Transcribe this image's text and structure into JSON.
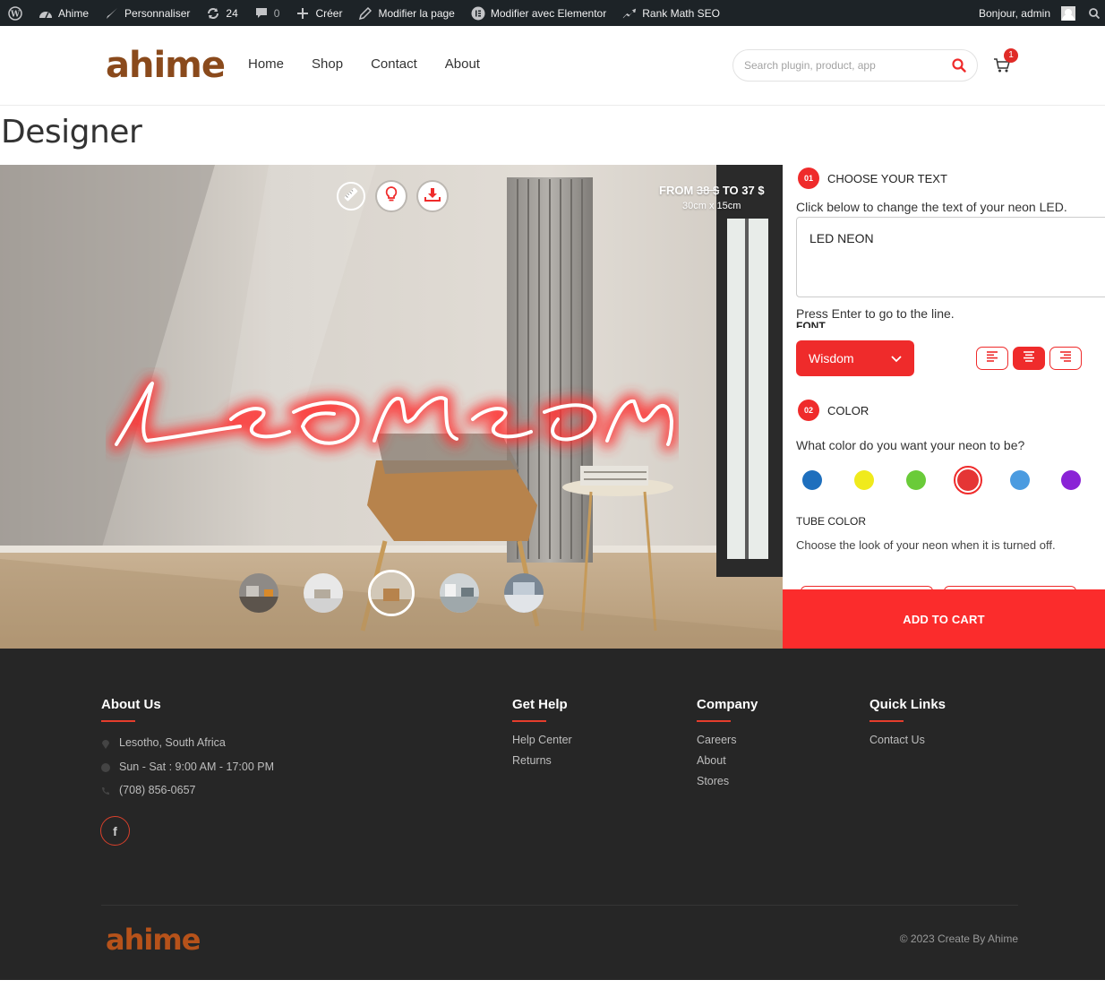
{
  "adminbar": {
    "site": "Ahime",
    "customize": "Personnaliser",
    "updates": "24",
    "comments": "0",
    "new": "Créer",
    "edit_page": "Modifier la page",
    "elementor": "Modifier avec Elementor",
    "rankmath": "Rank Math SEO",
    "greeting": "Bonjour, admin"
  },
  "header": {
    "logo": "ahime",
    "nav": [
      "Home",
      "Shop",
      "Contact",
      "About"
    ],
    "search_placeholder": "Search plugin, product, app",
    "cart_count": "1"
  },
  "page": {
    "title": "Designer"
  },
  "preview": {
    "price_prefix": "FROM",
    "price_old": "38 $",
    "price_mid": "TO",
    "price_new": "37 $",
    "size": "30cm x 15cm",
    "neon_text": "Led neon",
    "neon_color": "#ff3333",
    "thumb_count": 5,
    "active_thumb": 3,
    "tools": [
      "ruler-icon",
      "bulb-icon",
      "download-icon"
    ]
  },
  "options": {
    "step1": {
      "num": "01",
      "title": "CHOOSE YOUR TEXT"
    },
    "text_hint": "Click below to change the text of your neon LED.",
    "text_value": "LED NEON",
    "enter_hint": "Press Enter to go to the line.",
    "font_label": "FONT",
    "font_value": "Wisdom",
    "step2": {
      "num": "02",
      "title": "COLOR"
    },
    "color_question": "What color do you want your neon to be?",
    "colors": [
      "#1e6fbd",
      "#f0ea1c",
      "#6acb39",
      "#e53535",
      "#4b9be0",
      "#8a23d6"
    ],
    "selected_color": "#e53535",
    "tube_label": "TUBE COLOR",
    "tube_desc": "Choose the look of your neon when it is turned off.",
    "add_to_cart": "ADD TO CART",
    "accent": "#ef2b2b"
  },
  "footer": {
    "about": {
      "title": "About Us",
      "location": "Lesotho, South Africa",
      "hours": "Sun - Sat : 9:00 AM - 17:00 PM",
      "phone": "(708) 856-0657"
    },
    "help": {
      "title": "Get Help",
      "links": [
        "Help Center",
        "Returns"
      ]
    },
    "company": {
      "title": "Company",
      "links": [
        "Careers",
        "About",
        "Stores"
      ]
    },
    "quick": {
      "title": "Quick Links",
      "links": [
        "Contact Us"
      ]
    },
    "logo": "ahime",
    "copyright": "© 2023 Create By Ahime"
  }
}
